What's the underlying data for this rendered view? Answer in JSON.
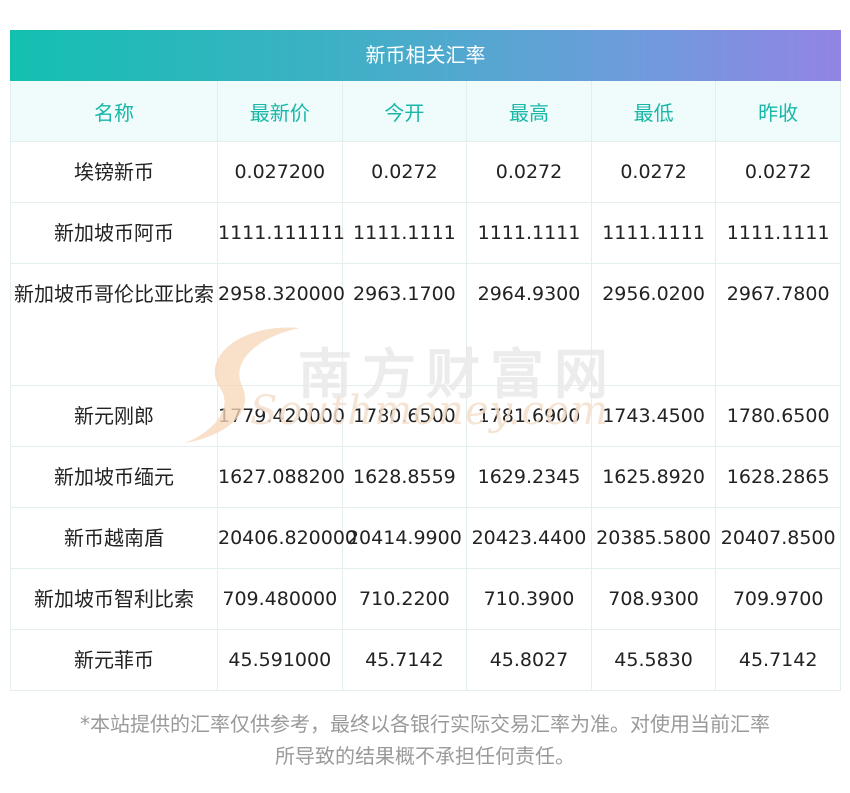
{
  "table": {
    "title": "新币相关汇率",
    "headers": [
      "名称",
      "最新价",
      "今开",
      "最高",
      "最低",
      "昨收"
    ],
    "rows": [
      {
        "name": "埃镑新币",
        "values": [
          "0.027200",
          "0.0272",
          "0.0272",
          "0.0272",
          "0.0272"
        ]
      },
      {
        "name": "新加坡币阿币",
        "values": [
          "1111.111111",
          "1111.1111",
          "1111.1111",
          "1111.1111",
          "1111.1111"
        ]
      },
      {
        "name": "新加坡币哥伦比亚比索",
        "values": [
          "2958.320000",
          "2963.1700",
          "2964.9300",
          "2956.0200",
          "2967.7800"
        ]
      },
      {
        "name": "新元刚郎",
        "values": [
          "1779.420000",
          "1780.6500",
          "1781.6900",
          "1743.4500",
          "1780.6500"
        ]
      },
      {
        "name": "新加坡币缅元",
        "values": [
          "1627.088200",
          "1628.8559",
          "1629.2345",
          "1625.8920",
          "1628.2865"
        ]
      },
      {
        "name": "新币越南盾",
        "values": [
          "20406.820000",
          "20414.9900",
          "20423.4400",
          "20385.5800",
          "20407.8500"
        ]
      },
      {
        "name": "新加坡币智利比索",
        "values": [
          "709.480000",
          "710.2200",
          "710.3900",
          "708.9300",
          "709.9700"
        ]
      },
      {
        "name": "新元菲币",
        "values": [
          "45.591000",
          "45.7142",
          "45.8027",
          "45.5830",
          "45.7142"
        ]
      }
    ]
  },
  "watermark": {
    "cn": "南方财富网",
    "en": "Southmoney.com"
  },
  "note": {
    "line1": "*本站提供的汇率仅供参考，最终以各银行实际交易汇率为准。对使用当前汇率",
    "line2": "所导致的结果概不承担任何责任。"
  },
  "colors": {
    "header_gradient_start": "#13c0b0",
    "header_gradient_end": "#9284e4",
    "accent": "#18b7a8",
    "header_bg": "#effcfb"
  }
}
